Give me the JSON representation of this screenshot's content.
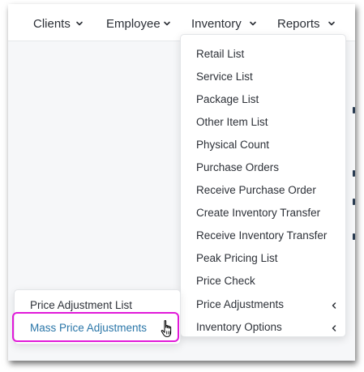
{
  "nav": {
    "items": [
      {
        "label": "Clients"
      },
      {
        "label": "Employee"
      },
      {
        "label": "Inventory"
      },
      {
        "label": "Reports"
      }
    ]
  },
  "inventory_menu": {
    "items": [
      {
        "label": "Retail List",
        "has_submenu": false
      },
      {
        "label": "Service List",
        "has_submenu": false
      },
      {
        "label": "Package List",
        "has_submenu": false
      },
      {
        "label": "Other Item List",
        "has_submenu": false
      },
      {
        "label": "Physical Count",
        "has_submenu": false
      },
      {
        "label": "Purchase Orders",
        "has_submenu": false
      },
      {
        "label": "Receive Purchase Order",
        "has_submenu": false
      },
      {
        "label": "Create Inventory Transfer",
        "has_submenu": false
      },
      {
        "label": "Receive Inventory Transfer",
        "has_submenu": false
      },
      {
        "label": "Peak Pricing List",
        "has_submenu": false
      },
      {
        "label": "Price Check",
        "has_submenu": false
      },
      {
        "label": "Price Adjustments",
        "has_submenu": true
      },
      {
        "label": "Inventory Options",
        "has_submenu": true
      }
    ]
  },
  "price_adjustments_submenu": {
    "items": [
      {
        "label": "Price Adjustment List",
        "active": false
      },
      {
        "label": "Mass Price Adjustments",
        "active": true
      }
    ]
  },
  "colors": {
    "highlight": "#e11ad9",
    "active_link": "#2a76a8",
    "text": "#2d3138"
  }
}
